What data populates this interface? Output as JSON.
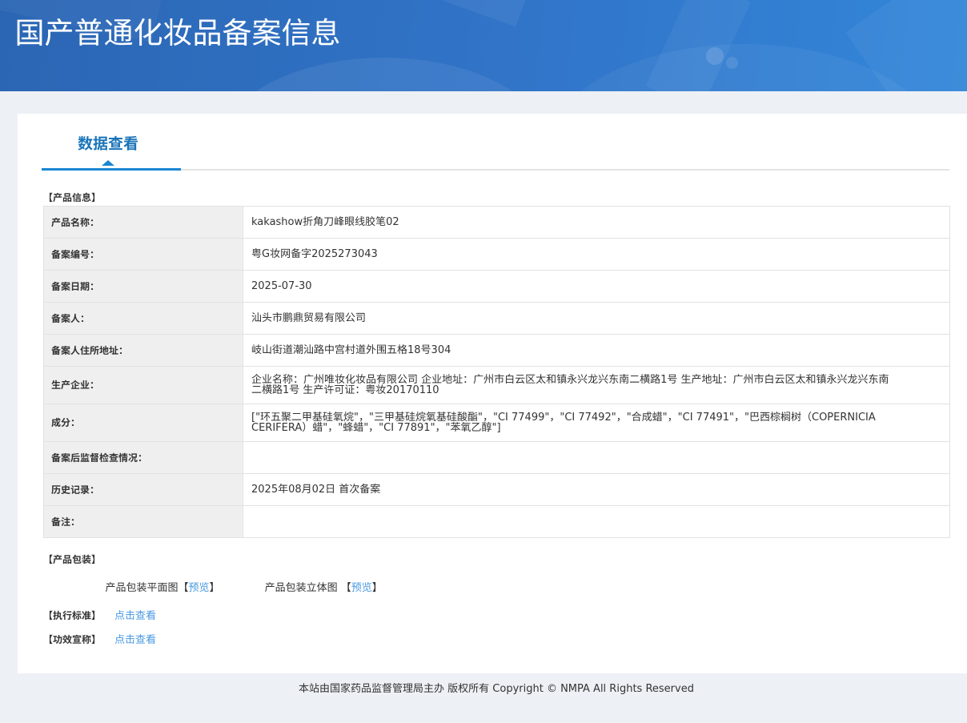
{
  "banner": {
    "title": "国产普通化妆品备案信息"
  },
  "tabs": [
    {
      "label": "数据查看",
      "active": true
    }
  ],
  "sections": {
    "product_info": "【产品信息】",
    "packaging": "【产品包装】",
    "standard": "【执行标准】",
    "efficacy": "【功效宣称】"
  },
  "table": {
    "rows": [
      {
        "label": "产品名称：",
        "value": "kakashow折角刀峰眼线胶笔02"
      },
      {
        "label": "备案编号：",
        "value": "粤G妆网备字2025273043"
      },
      {
        "label": "备案日期：",
        "value": "2025-07-30"
      },
      {
        "label": "备案人：",
        "value": "汕头市鹏鼎贸易有限公司"
      },
      {
        "label": "备案人住所地址：",
        "value": "岐山街道潮汕路中宫村道外围五格18号304"
      },
      {
        "label": "生产企业：",
        "value": "企业名称：广州唯妆化妆品有限公司 企业地址：广州市白云区太和镇永兴龙兴东南二横路1号 生产地址：广州市白云区太和镇永兴龙兴东南二横路1号 生产许可证：粤妆20170110"
      },
      {
        "label": "成分：",
        "value": "[\"环五聚二甲基硅氧烷\"，\"三甲基硅烷氧基硅酸酯\"，\"CI 77499\"，\"CI 77492\"，\"合成蜡\"，\"CI 77491\"，\"巴西棕榈树（COPERNICIA CERIFERA）蜡\"，\"蜂蜡\"，\"CI 77891\"，\"苯氧乙醇\"]"
      },
      {
        "label": "备案后监督检查情况：",
        "value": ""
      },
      {
        "label": "历史记录：",
        "value": "2025年08月02日 首次备案"
      },
      {
        "label": "备注：",
        "value": ""
      }
    ]
  },
  "packaging": {
    "flat_label": "产品包装平面图",
    "stereo_label": "产品包装立体图",
    "preview_label": "预览",
    "bracket_open": "【",
    "bracket_close": "】"
  },
  "links": {
    "click_view": "点击查看"
  },
  "footer": {
    "text": "本站由国家药品监督管理局主办 版权所有 Copyright © NMPA All Rights Reserved"
  },
  "colors": {
    "banner_blue_left": "#2b66b4",
    "banner_blue_right": "#3286d9",
    "tab_text_blue": "#1a74b9",
    "tab_underline_blue": "#1b86d3",
    "link_blue": "#4a9ae2",
    "table_outer_border": "#8cb0dd",
    "label_cell_bg": "#efefef",
    "text_dark": "#333333",
    "page_bg": "#edf0f5"
  }
}
